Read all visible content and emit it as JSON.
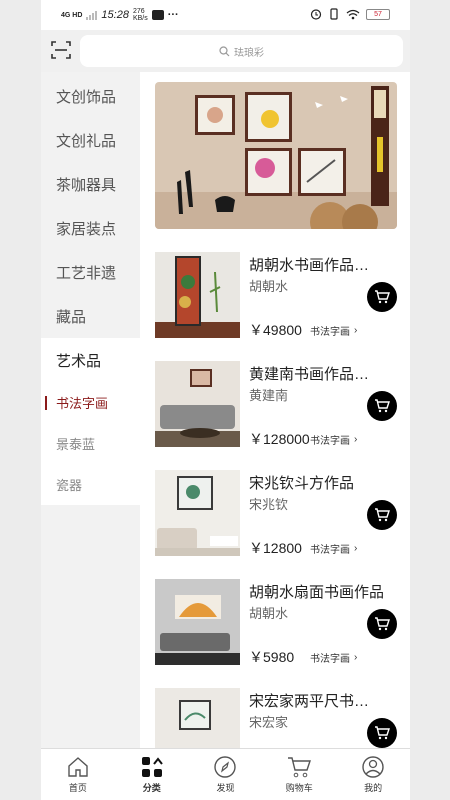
{
  "status": {
    "network": "4G HD",
    "time": "15:28",
    "speed_value": "276",
    "speed_unit": "KB/s",
    "more": "···",
    "battery": "57"
  },
  "search": {
    "placeholder": "珐琅彩"
  },
  "sidebar": {
    "items": [
      {
        "label": "文创饰品"
      },
      {
        "label": "文创礼品"
      },
      {
        "label": "茶咖器具"
      },
      {
        "label": "家居装点"
      },
      {
        "label": "工艺非遗"
      },
      {
        "label": "藏品"
      },
      {
        "label": "艺术品"
      }
    ],
    "subitems": [
      {
        "label": "书法字画"
      },
      {
        "label": "景泰蓝"
      },
      {
        "label": "瓷器"
      }
    ]
  },
  "products": [
    {
      "title": "胡朝水书画作品…",
      "author": "胡朝水",
      "price": "￥49800",
      "category": "书法字画"
    },
    {
      "title": "黄建南书画作品…",
      "author": "黄建南",
      "price": "￥128000",
      "category": "书法字画"
    },
    {
      "title": "宋兆钦斗方作品",
      "author": "宋兆钦",
      "price": "￥12800",
      "category": "书法字画"
    },
    {
      "title": "胡朝水扇面书画作品",
      "author": "胡朝水",
      "price": "￥5980",
      "category": "书法字画"
    },
    {
      "title": "宋宏家两平尺书…",
      "author": "宋宏家",
      "price": "",
      "category": ""
    }
  ],
  "bottom_nav": [
    {
      "label": "首页",
      "icon": "home-icon"
    },
    {
      "label": "分类",
      "icon": "category-icon"
    },
    {
      "label": "发现",
      "icon": "compass-icon"
    },
    {
      "label": "购物车",
      "icon": "cart-icon"
    },
    {
      "label": "我的",
      "icon": "profile-icon"
    }
  ],
  "colors": {
    "accent": "#8b1a1a",
    "sidebar_bg": "#f2f2f2",
    "cart_button": "#000000"
  }
}
